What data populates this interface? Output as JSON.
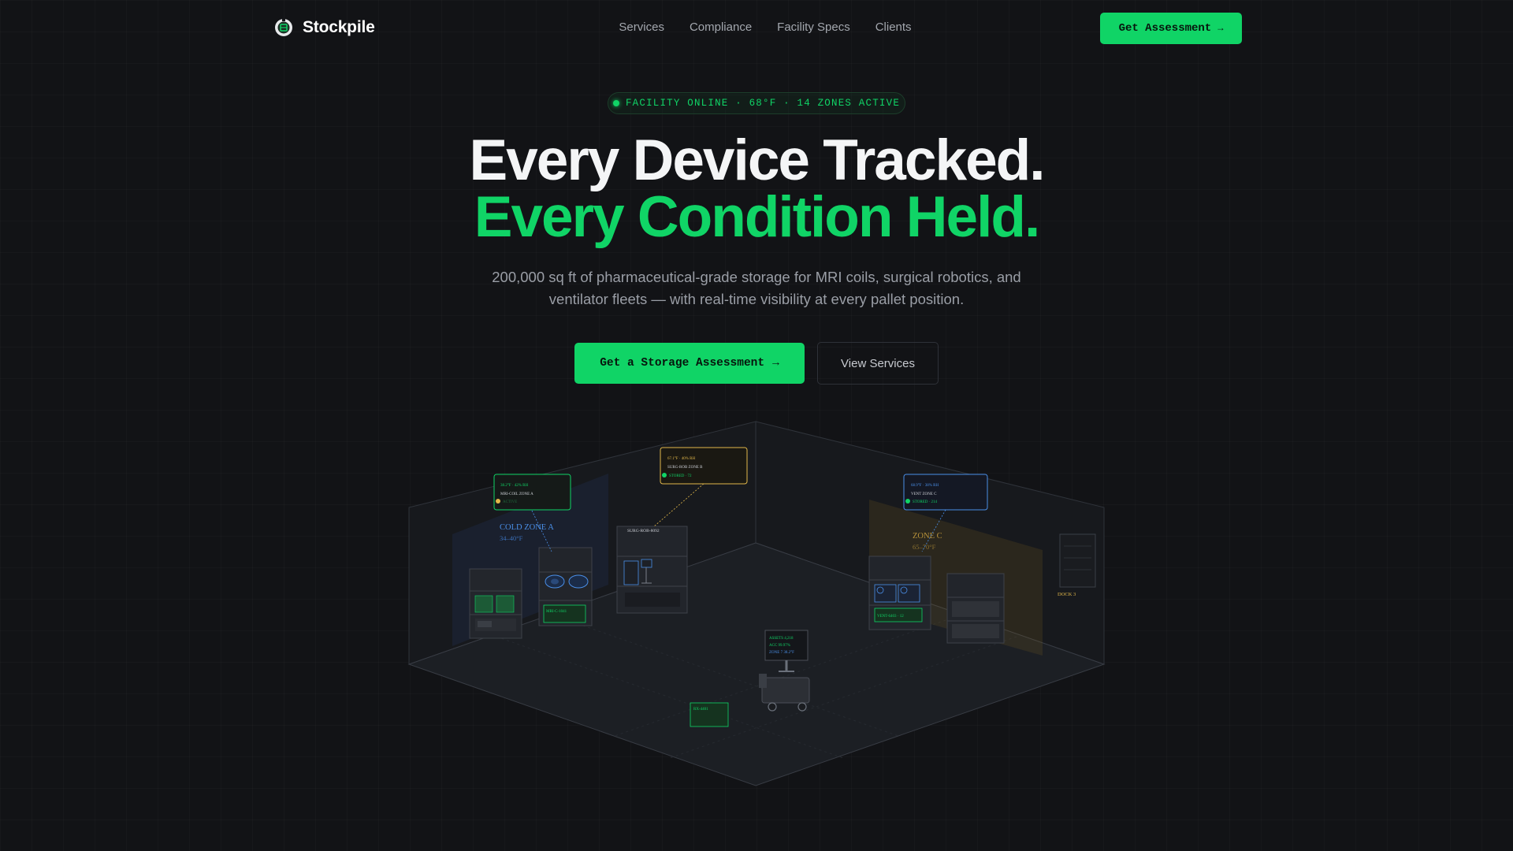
{
  "nav": {
    "brand": "Stockpile",
    "links": [
      "Services",
      "Compliance",
      "Facility Specs",
      "Clients"
    ],
    "cta_label": "Get Assessment",
    "cta_arrow": "→"
  },
  "status": {
    "text": "FACILITY ONLINE · 68°F · 14 ZONES ACTIVE"
  },
  "hero": {
    "title_line1": "Every Device Tracked.",
    "title_line2": "Every Condition Held.",
    "subtitle": "200,000 sq ft of pharmaceutical-grade storage for MRI coils, surgical robotics, and ventilator fleets — with real-time visibility at every pallet position.",
    "primary_button": "Get a Storage Assessment",
    "primary_arrow": "→",
    "secondary_button": "View Services"
  },
  "warehouse": {
    "zones": {
      "cold_zone_title": "COLD ZONE A",
      "cold_zone_range": "34–40°F",
      "zone_c_title": "ZONE C",
      "zone_c_range": "65–70°F",
      "dock": "DOCK 3"
    },
    "sensors": {
      "a": {
        "reading": "38.2°F · 42% RH",
        "name": "MRI-COIL ZONE A",
        "status": "ACTIVE"
      },
      "b": {
        "reading": "67.1°F · 40% RH",
        "name": "SURG-ROB ZONE B",
        "status": "STORED · 72"
      },
      "c": {
        "reading": "68.9°F · 38% RH",
        "name": "VENT ZONE C",
        "status": "STORED · 214"
      }
    },
    "equipment": {
      "mri_label": "MRI-C-1041",
      "robot_label": "SURG-ROB-8092",
      "vent_label": "VENT-6403 · 12",
      "floor_tag": "RX-4401",
      "monitor_line1": "ASSETS 4,218",
      "monitor_line2": "ACC 99.97%",
      "monitor_line3": "ZONE 7 38.2°F"
    },
    "colors": {
      "green": "#10d466",
      "blue": "#4a8fe8",
      "amber": "#e2b84a"
    }
  }
}
